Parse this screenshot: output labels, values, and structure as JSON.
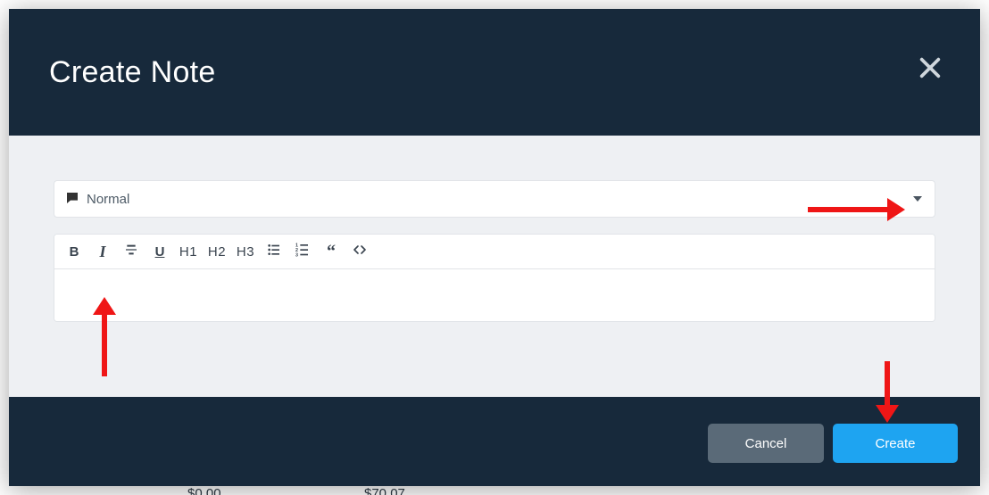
{
  "modal": {
    "title": "Create Note",
    "type_selector": {
      "label": "Normal"
    },
    "toolbar": {
      "bold": "B",
      "italic": "I",
      "h1": "H1",
      "h2": "H2",
      "h3": "H3"
    },
    "editor": {
      "content": ""
    },
    "footer": {
      "cancel": "Cancel",
      "create": "Create"
    }
  },
  "background": {
    "value_a": "$0.00",
    "value_b": "$70.07"
  }
}
